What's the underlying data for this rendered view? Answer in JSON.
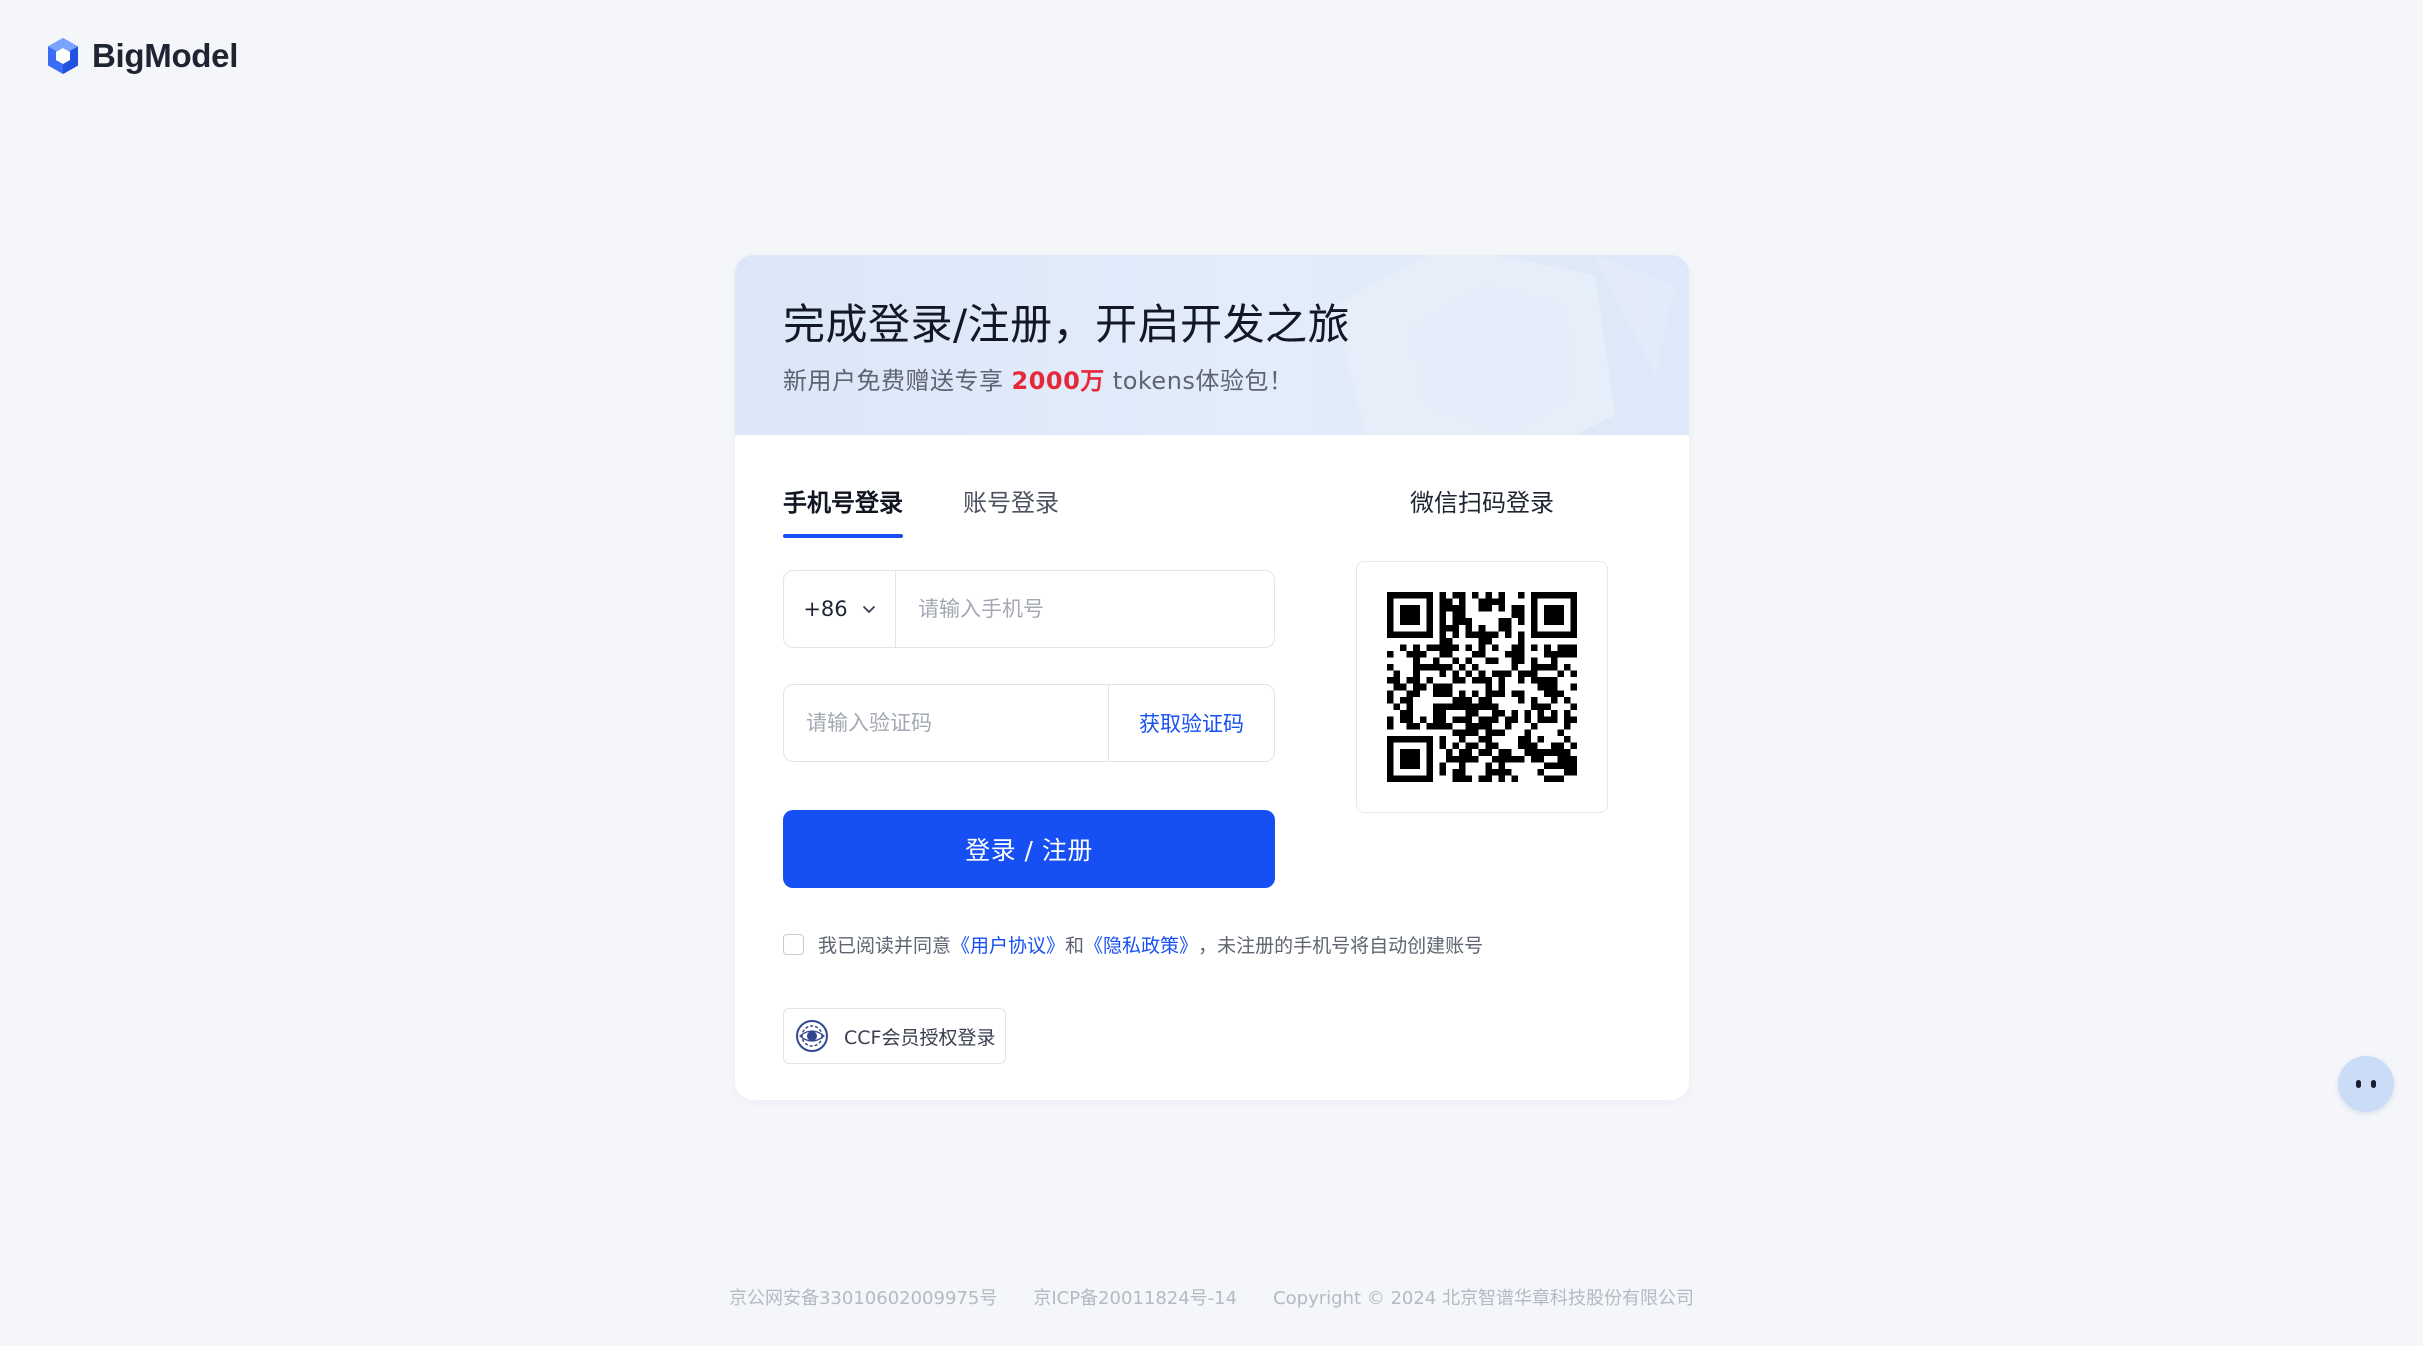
{
  "logo": {
    "brand": "BigModel",
    "icon": "bigmodel-logo-icon"
  },
  "banner": {
    "title": "完成登录/注册，开启开发之旅",
    "subtitle_prefix": "新用户免费赠送专享",
    "subtitle_highlight": "2000万",
    "subtitle_suffix": "tokens体验包！"
  },
  "tabs": [
    {
      "label": "手机号登录",
      "active": true
    },
    {
      "label": "账号登录",
      "active": false
    }
  ],
  "phone": {
    "country_code": "+86",
    "placeholder": "请输入手机号",
    "value": ""
  },
  "code": {
    "placeholder": "请输入验证码",
    "value": "",
    "get_code_label": "获取验证码"
  },
  "login_button": "登录 / 注册",
  "agreement": {
    "checked": false,
    "prefix": "我已阅读并同意",
    "user_agreement": "《用户协议》",
    "and": "和",
    "privacy_policy": "《隐私政策》",
    "suffix": "，未注册的手机号将自动创建账号"
  },
  "ccf": {
    "label": "CCF会员授权登录",
    "icon": "ccf-logo-icon"
  },
  "wechat": {
    "title": "微信扫码登录",
    "icon": "qr-code-icon"
  },
  "footer": {
    "police_record": "京公网安备33010602009975号",
    "icp_record": "京ICP备20011824号-14",
    "copyright": "Copyright © 2024 北京智谱华章科技股份有限公司"
  },
  "assistant": {
    "icon": "assistant-face-icon"
  },
  "colors": {
    "accent": "#1650f5",
    "highlight": "#e5283a",
    "background": "#f4f6fa",
    "banner": "#dfe8f8"
  }
}
